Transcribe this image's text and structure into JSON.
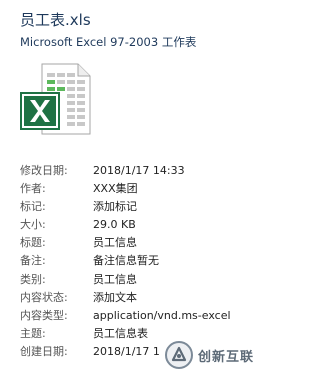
{
  "file": {
    "name": "员工表.xls",
    "type": "Microsoft Excel 97-2003 工作表",
    "icon": "excel-file-icon"
  },
  "properties": [
    {
      "label": "修改日期:",
      "value": "2018/1/17 14:33"
    },
    {
      "label": "作者:",
      "value": "XXX集团"
    },
    {
      "label": "标记:",
      "value": "添加标记"
    },
    {
      "label": "大小:",
      "value": "29.0 KB"
    },
    {
      "label": "标题:",
      "value": "员工信息"
    },
    {
      "label": "备注:",
      "value": "备注信息暂无"
    },
    {
      "label": "类别:",
      "value": "员工信息"
    },
    {
      "label": "内容状态:",
      "value": "添加文本"
    },
    {
      "label": "内容类型:",
      "value": "application/vnd.ms-excel"
    },
    {
      "label": "主题:",
      "value": "员工信息表"
    },
    {
      "label": "创建日期:",
      "value": "2018/1/17 1"
    }
  ],
  "watermark": {
    "text": "创新互联",
    "icon": "brand-logo-icon"
  },
  "colors": {
    "title": "#1e395b",
    "excel_green": "#1f7244",
    "excel_light_green": "#4caf50"
  }
}
